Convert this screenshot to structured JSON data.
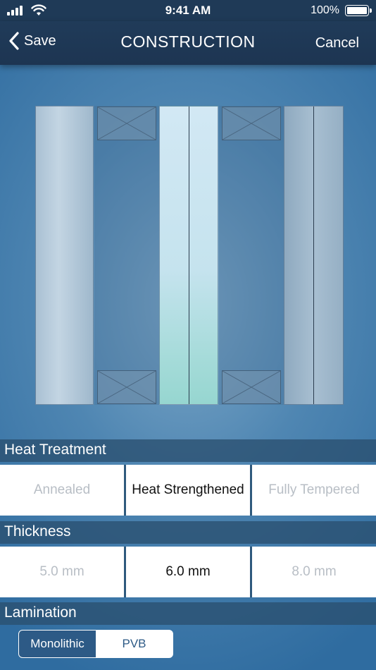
{
  "status_bar": {
    "time": "9:41 AM",
    "battery": "100%"
  },
  "nav": {
    "back_label": "Save",
    "title": "CONSTRUCTION",
    "cancel_label": "Cancel"
  },
  "heat_treatment": {
    "header": "Heat Treatment",
    "options": [
      "Annealed",
      "Heat Strengthened",
      "Fully Tempered"
    ],
    "selected": "Heat Strengthened"
  },
  "thickness": {
    "header": "Thickness",
    "options": [
      "5.0 mm",
      "6.0 mm",
      "8.0 mm"
    ],
    "selected": "6.0 mm"
  },
  "lamination": {
    "header": "Lamination",
    "options": [
      "Monolithic",
      "PVB"
    ],
    "selected": "Monolithic"
  },
  "icons": [
    "cellular-signal-icon",
    "wifi-icon",
    "battery-icon",
    "chevron-left-icon"
  ]
}
